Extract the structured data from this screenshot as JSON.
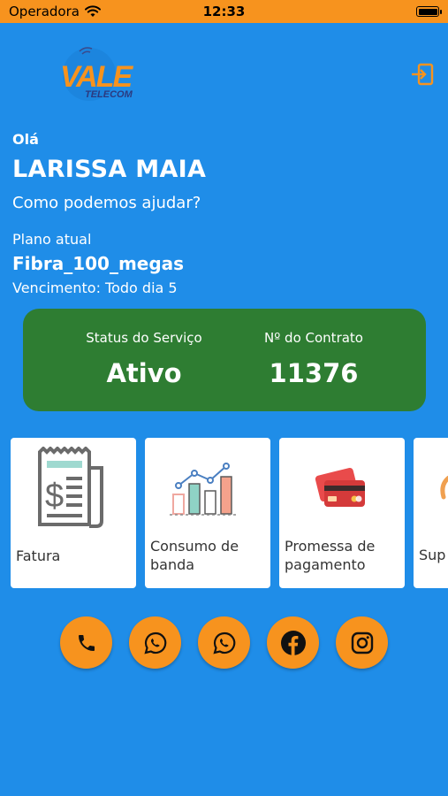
{
  "status_bar": {
    "carrier": "Operadora",
    "time": "12:33"
  },
  "header": {
    "logo_text_main": "VALE",
    "logo_text_sub": "TELECOM",
    "logout_icon": "logout-icon"
  },
  "user": {
    "greeting": "Olá",
    "name": "LARISSA MAIA",
    "help_prompt": "Como podemos ajudar?",
    "plan_label": "Plano atual",
    "plan_name": "Fibra_100_megas",
    "due_text": "Vencimento: Todo dia 5"
  },
  "service_card": {
    "status_label": "Status do Serviço",
    "status_value": "Ativo",
    "contract_label": "Nº do Contrato",
    "contract_value": "11376",
    "color": "#2e7d32"
  },
  "tiles": [
    {
      "label": "Fatura",
      "icon": "invoice-icon"
    },
    {
      "label": "Consumo de banda",
      "icon": "bar-chart-icon"
    },
    {
      "label": "Promessa de pagamento",
      "icon": "credit-card-icon"
    },
    {
      "label": "Sup",
      "icon": "support-icon"
    }
  ],
  "socials": [
    {
      "name": "phone",
      "icon": "phone-icon"
    },
    {
      "name": "whatsapp",
      "icon": "whatsapp-icon"
    },
    {
      "name": "whatsapp",
      "icon": "whatsapp-icon"
    },
    {
      "name": "facebook",
      "icon": "facebook-icon"
    },
    {
      "name": "instagram",
      "icon": "instagram-icon"
    }
  ],
  "colors": {
    "background": "#1f8de8",
    "accent": "#f7931e",
    "card": "#2e7d32"
  }
}
